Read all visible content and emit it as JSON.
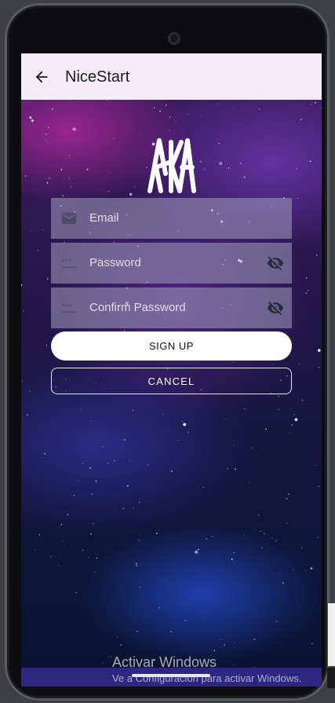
{
  "appbar": {
    "title": "NiceStart"
  },
  "icons": {
    "back": "arrow-left-icon",
    "logo": "aka-logo",
    "email": "email-icon",
    "password": "password-dots-icon",
    "visibility": "eye-off-icon"
  },
  "form": {
    "email_placeholder": "Email",
    "password_placeholder": "Password",
    "confirm_placeholder": "Confirm Password"
  },
  "buttons": {
    "signup": "SIGN UP",
    "cancel": "CANCEL"
  },
  "watermark": {
    "line1": "Activar Windows",
    "line2": "Ve a Configuración para activar Windows."
  },
  "colors": {
    "appbar": "#f3ecf6",
    "field": "#a0a0be",
    "primary_button": "#ffffff"
  }
}
